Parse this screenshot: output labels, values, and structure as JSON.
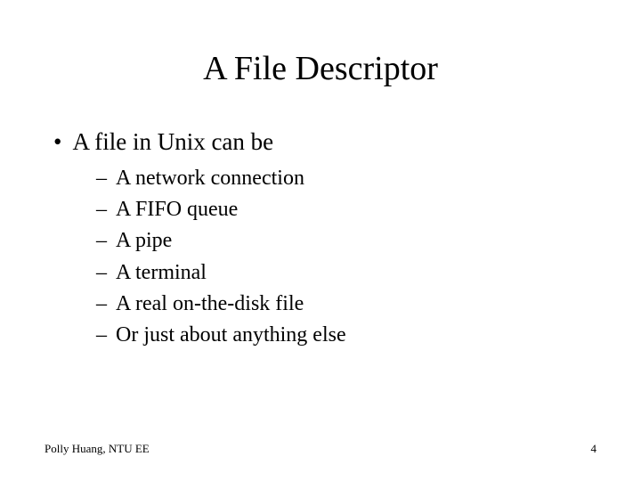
{
  "title": "A File Descriptor",
  "bullet1": "A file in Unix can be",
  "sub_bullets": [
    "A network connection",
    "A FIFO queue",
    "A pipe",
    "A terminal",
    "A real on-the-disk file",
    "Or just about anything else"
  ],
  "footer_left": "Polly Huang, NTU EE",
  "footer_right": "4"
}
